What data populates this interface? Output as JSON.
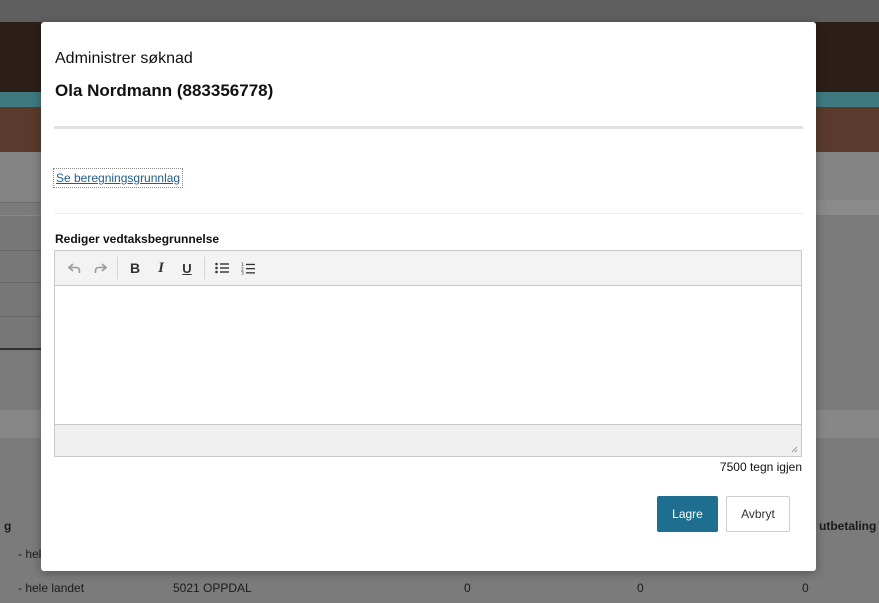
{
  "modal": {
    "subtitle": "Administrer søknad",
    "title": "Ola Nordmann (883356778)",
    "calc_link": "Se beregningsgrunnlag",
    "editor_label": "Rediger vedtaksbegrunnelse",
    "editor_value": "",
    "char_count": "7500 tegn igjen",
    "save_label": "Lagre",
    "cancel_label": "Avbryt",
    "toolbar": {
      "undo_icon": "undo-icon",
      "redo_icon": "redo-icon",
      "bold_glyph": "B",
      "italic_glyph": "I",
      "underline_glyph": "U",
      "bullet_icon": "bullet-list-icon",
      "number_icon": "numbered-list-icon"
    }
  },
  "background": {
    "col_fragment_left": "g",
    "col_fragment_right": "utbetaling",
    "row1_text": "- hele",
    "row2": {
      "region": "- hele landet",
      "municipality": "5021 OPPDAL",
      "v1": "0",
      "v2": "0",
      "v3": "0"
    }
  },
  "colors": {
    "primary": "#1d6e8f",
    "link": "#1f5d8c",
    "overlay": "#7b7b7b"
  }
}
